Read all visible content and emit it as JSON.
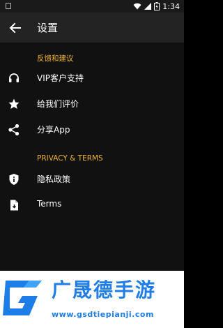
{
  "status_bar": {
    "time": "1:34",
    "icons": [
      "sim-icon",
      "wifi-icon",
      "signal-icon",
      "battery-icon"
    ]
  },
  "app_bar": {
    "title": "设置",
    "back_icon": "arrow-left-icon"
  },
  "sections": [
    {
      "header": "反馈和建议",
      "items": [
        {
          "label": "VIP客户支持",
          "icon": "headset-icon"
        },
        {
          "label": "给我们评价",
          "icon": "star-icon"
        },
        {
          "label": "分享App",
          "icon": "share-icon"
        }
      ]
    },
    {
      "header": "PRIVACY & TERMS",
      "items": [
        {
          "label": "隐私政策",
          "icon": "shield-icon"
        },
        {
          "label": "Terms",
          "icon": "document-icon"
        }
      ]
    }
  ],
  "watermark": {
    "brand": "广晟德手游",
    "url": "www.gsdtiepianji.com"
  },
  "colors": {
    "accent": "#f2b233",
    "background": "#111111",
    "appbar": "#232323",
    "brand_blue": "#1e7de6"
  }
}
